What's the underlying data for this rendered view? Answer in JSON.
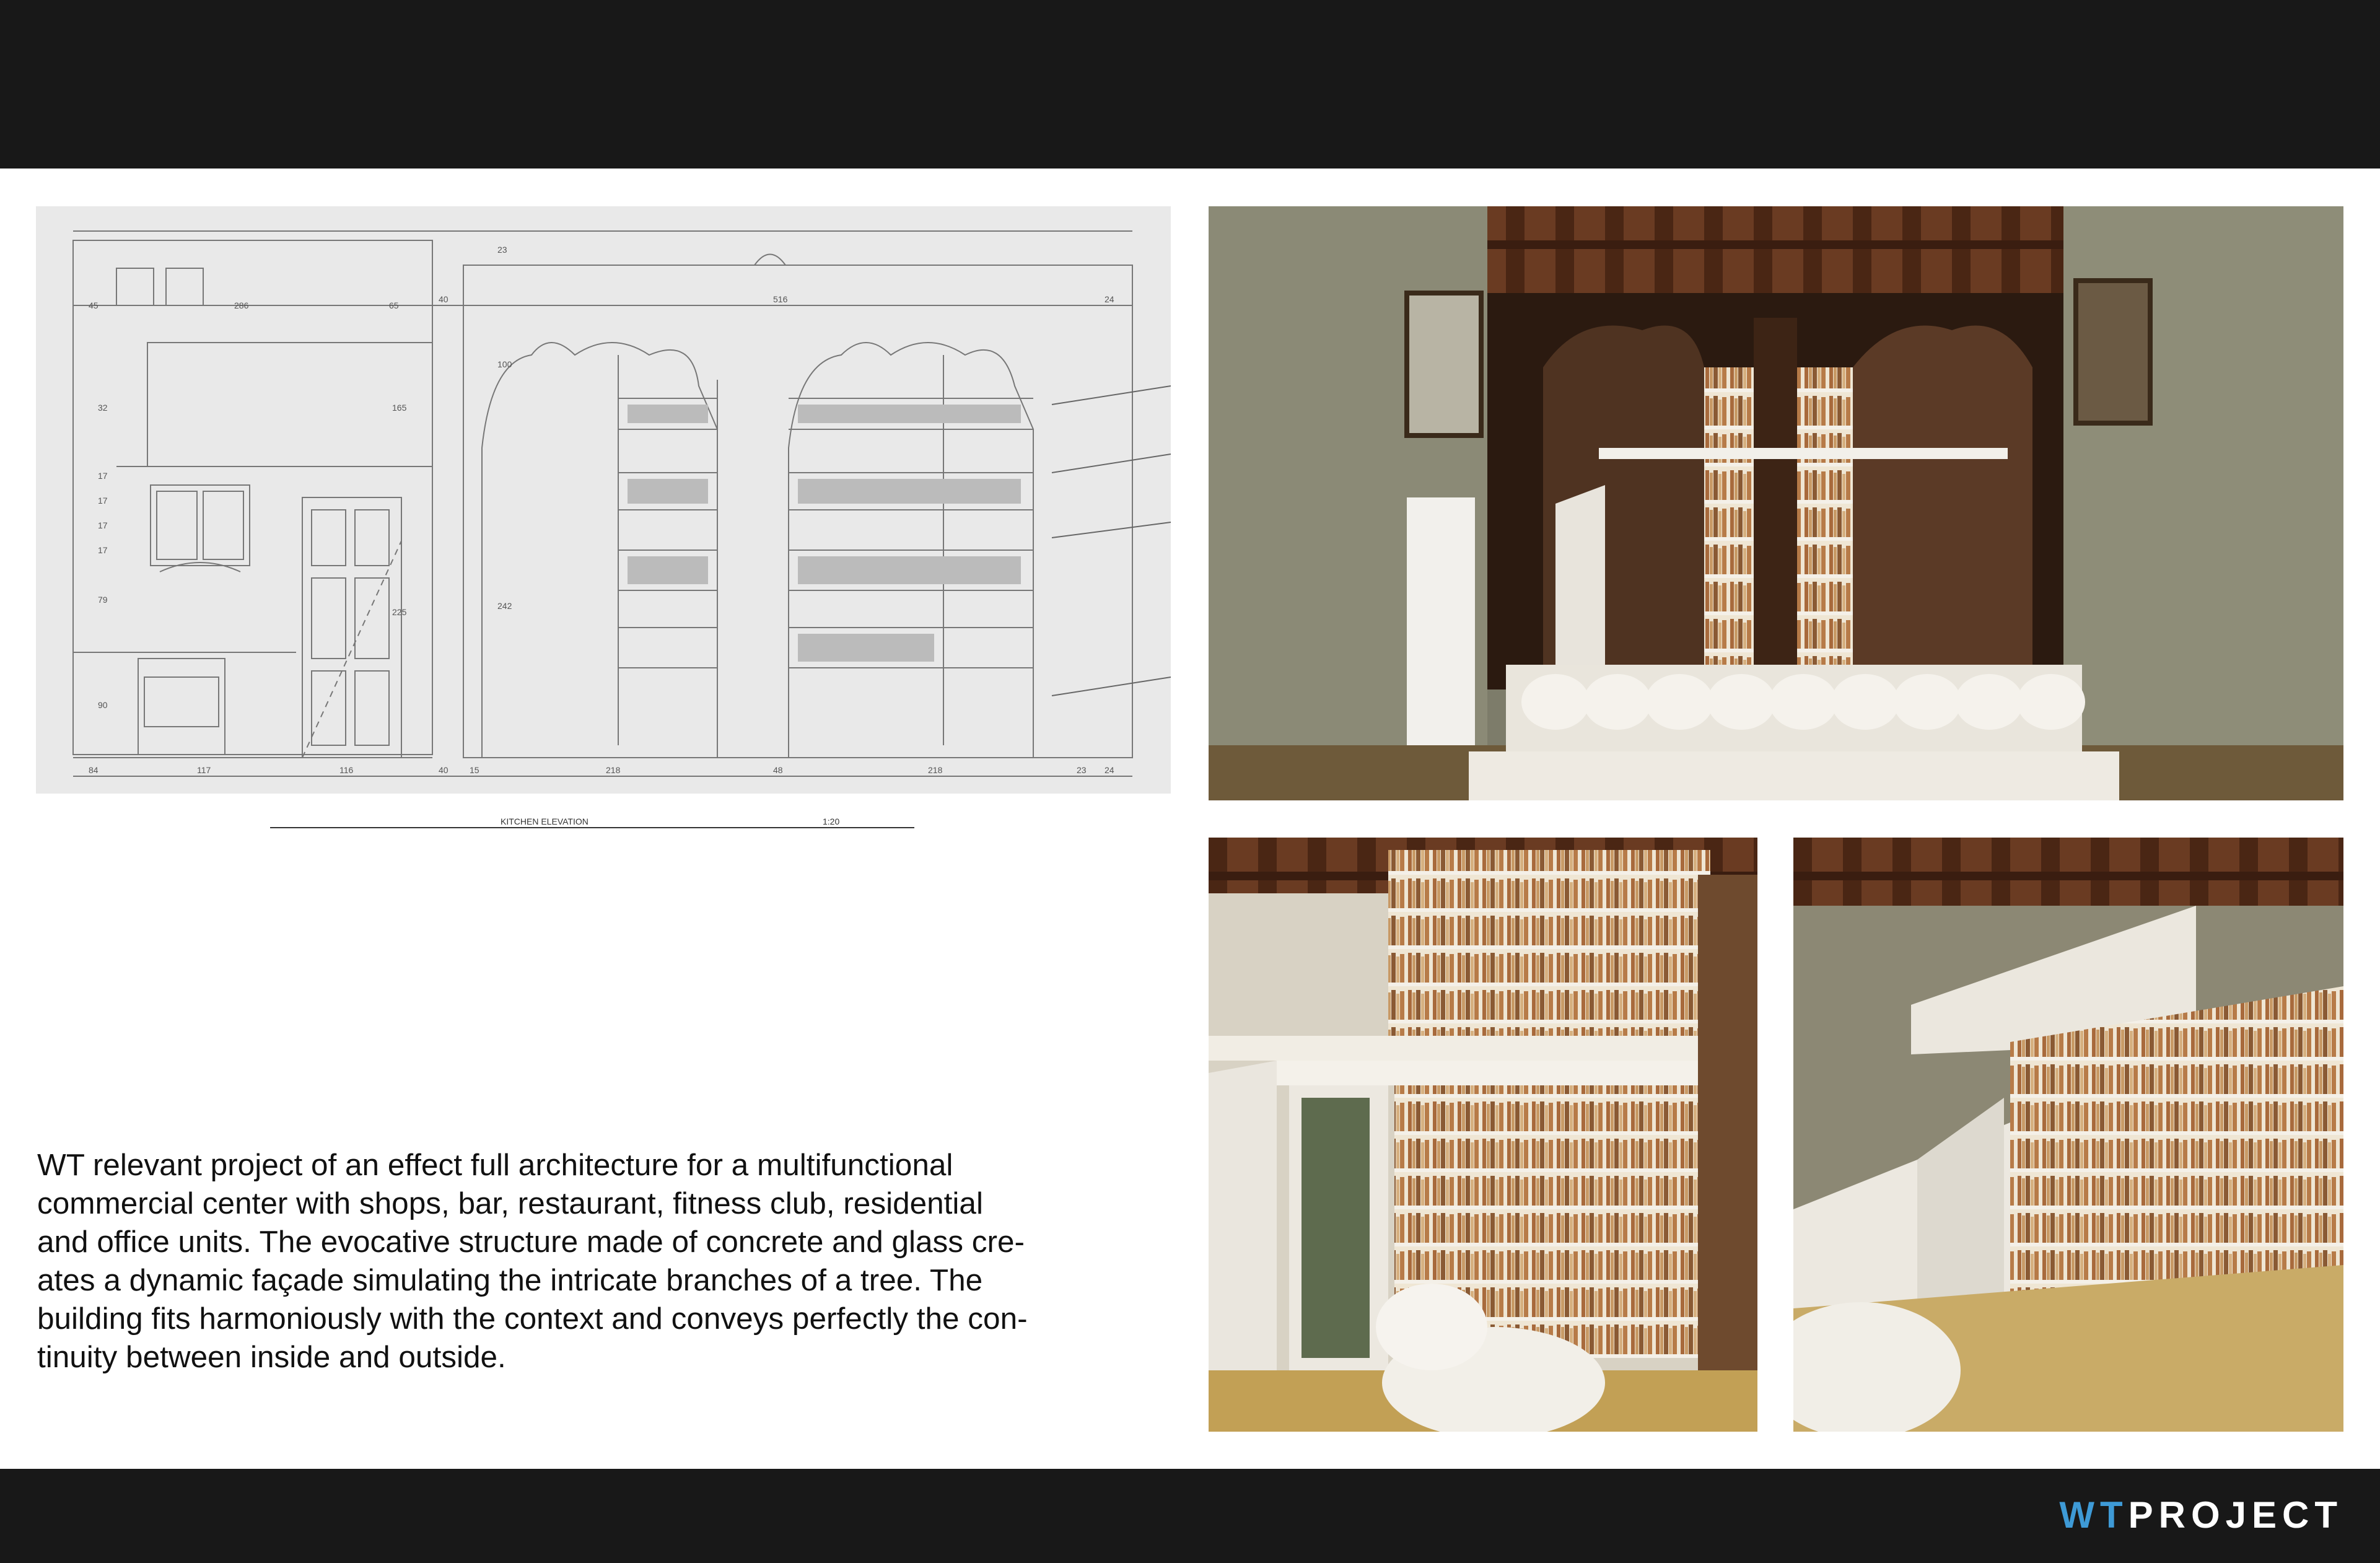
{
  "drawing": {
    "dimensions_top": [
      "40",
      "516",
      "24"
    ],
    "dimensions_bottom": [
      "117",
      "116",
      "40",
      "15",
      "218",
      "48",
      "218",
      "23",
      "24"
    ],
    "dimensions_left": [
      "45",
      "286",
      "65",
      "32",
      "17",
      "17",
      "17",
      "17",
      "79",
      "90",
      "84",
      "23",
      "100",
      "165",
      "225",
      "242"
    ],
    "caption_title": "KITCHEN ELEVATION",
    "caption_scale": "1:20"
  },
  "description": "WT relevant project of an effect full architecture for a multifunctional commercial center with shops, bar, restaurant, fitness club, residential and office units. The evocative structure made of concrete and glass creates a dynamic façade simulating the intricate branches of a tree. The building fits harmoniously with the context and conveys perfectly the continuity between inside and outside.",
  "description_lines": [
    "WT relevant project of an effect full architecture for a multifunctional",
    "commercial center with shops, bar, restaurant, fitness club, residential",
    "and office units. The evocative structure made of concrete and glass cre-",
    "ates a dynamic façade simulating the intricate branches of a tree. The",
    "building fits harmoniously with the context and conveys perfectly the con-",
    "tinuity between inside and outside."
  ],
  "logo": {
    "part1": "WT",
    "part2": "PROJECT"
  },
  "colors": {
    "band": "#181818",
    "logo_accent": "#3e9ad6",
    "drawing_bg": "#e9e9e9"
  }
}
